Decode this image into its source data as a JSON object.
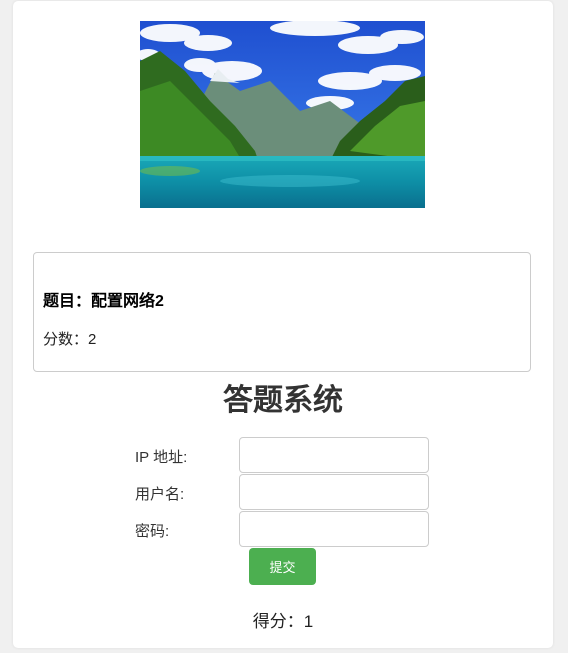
{
  "hero_image": {
    "alt_name": "mountain-lake-landscape"
  },
  "question": {
    "title_label": "题目：",
    "title_value": "配置网络2",
    "score_label": "分数：",
    "score_value": "2"
  },
  "system": {
    "title": "答题系统"
  },
  "form": {
    "ip_label": "IP 地址:",
    "ip_value": "",
    "username_label": "用户名:",
    "username_value": "",
    "password_label": "密码:",
    "password_value": "",
    "submit_label": "提交"
  },
  "result": {
    "label": "得分：",
    "value": "1"
  },
  "colors": {
    "accent": "#4caf50",
    "page_bg": "#f0f0f0",
    "card_bg": "#ffffff",
    "border": "#cccccc"
  }
}
